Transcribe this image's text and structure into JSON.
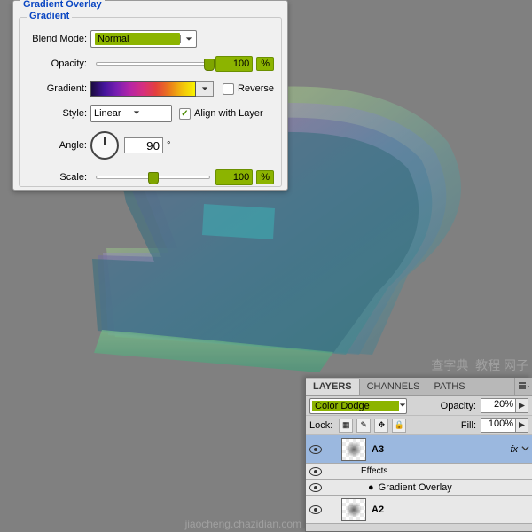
{
  "dialog": {
    "title": "Gradient Overlay",
    "group": "Gradient",
    "blendModeLabel": "Blend Mode:",
    "blendMode": "Normal",
    "opacityLabel": "Opacity:",
    "opacity": "100",
    "pct": "%",
    "gradientLabel": "Gradient:",
    "reverseLabel": "Reverse",
    "styleLabel": "Style:",
    "style": "Linear",
    "alignLabel": "Align with Layer",
    "angleLabel": "Angle:",
    "angle": "90",
    "degree": "°",
    "scaleLabel": "Scale:",
    "scale": "100"
  },
  "layers": {
    "tabs": [
      "LAYERS",
      "CHANNELS",
      "PATHS"
    ],
    "blendMode": "Color Dodge",
    "opacityLabel": "Opacity:",
    "opacity": "20%",
    "lockLabel": "Lock:",
    "fillLabel": "Fill:",
    "fill": "100%",
    "items": [
      {
        "name": "A3",
        "effects": "Effects",
        "sub": "Gradient Overlay",
        "fx": "fx"
      },
      {
        "name": "A2"
      }
    ]
  },
  "watermark": {
    "a": "查字典",
    "b": "教程 网子",
    "c": "jiaocheng.chazidian.com"
  }
}
